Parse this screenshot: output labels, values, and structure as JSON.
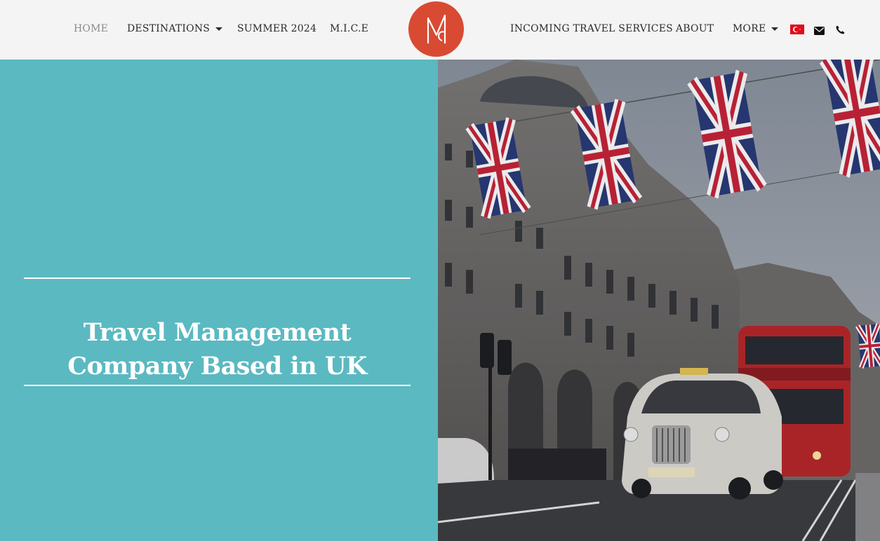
{
  "nav": {
    "home": "HOME",
    "destinations": "DESTINATIONS",
    "summer": "SUMMER 2024",
    "mice": "M.I.C.E",
    "incoming": "INCOMING TRAVEL SERVICES",
    "about": "ABOUT",
    "more": "MORE"
  },
  "icons": {
    "language_flag": "turkey-flag-icon",
    "email": "envelope-icon",
    "phone": "phone-icon",
    "dropdown": "caret-down-icon",
    "logo": "m-logo"
  },
  "hero": {
    "title_line1": "Travel Management",
    "title_line2": "Company Based in UK"
  },
  "colors": {
    "header_bg": "#f4f4f4",
    "logo_red": "#d94a33",
    "hero_teal": "#5bb9c1",
    "text_dark": "#2b2b2b",
    "nav_active": "#8a8a8a"
  }
}
